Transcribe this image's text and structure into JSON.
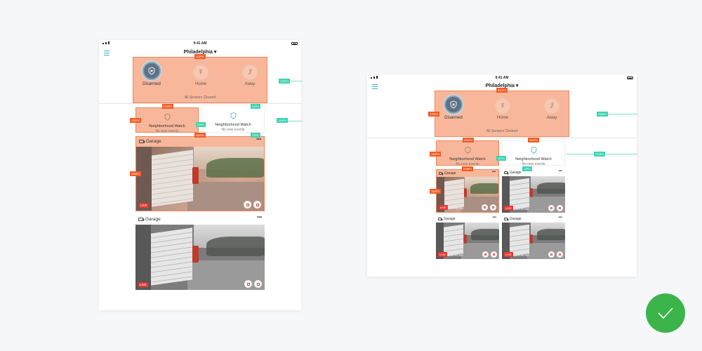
{
  "status_time": "9:41 AM",
  "location": "Philadelphia ▾",
  "modes": [
    {
      "label": "Disarmed",
      "icon": "shield-x-icon",
      "active": true
    },
    {
      "label": "Home",
      "icon": "person-icon",
      "active": false
    },
    {
      "label": "Away",
      "icon": "walking-icon",
      "active": false
    }
  ],
  "sensors_status": "All Sensors Cleared",
  "neighborhood_watch": {
    "title": "Neighborhood Watch",
    "subtitle": "No new events"
  },
  "camera": {
    "title": "Garage",
    "live": "LIVE",
    "timestamp": "11:32:00 AM",
    "more": "•••"
  },
  "annotations_left": {
    "panel_height": "113PX",
    "panel_right": "130PX",
    "nw_width": "226PX",
    "nw_height": "110PX",
    "nw_gap": "12PX",
    "nw_right": "140PX",
    "nw_edge": "12PX",
    "cam_width": "460PX",
    "cam_height": "296PX",
    "cam_edge": "12PX"
  },
  "annotations_right": {
    "panel_height": "175PX",
    "panel_width": "512PX",
    "panel_right": "258PX",
    "nw_width": "234PX",
    "nw_height": "100PX",
    "nw_width2": "234PX",
    "nw_gap": "12PX",
    "nw_right": "270PX",
    "cam_width": "234PX",
    "cam_height": "160PX",
    "cam_gap": "12PX"
  },
  "colors": {
    "accent": "#f25c26",
    "highlight": "#f8b79a",
    "measure_green": "#3fd2b0",
    "success": "#3bb54a"
  }
}
